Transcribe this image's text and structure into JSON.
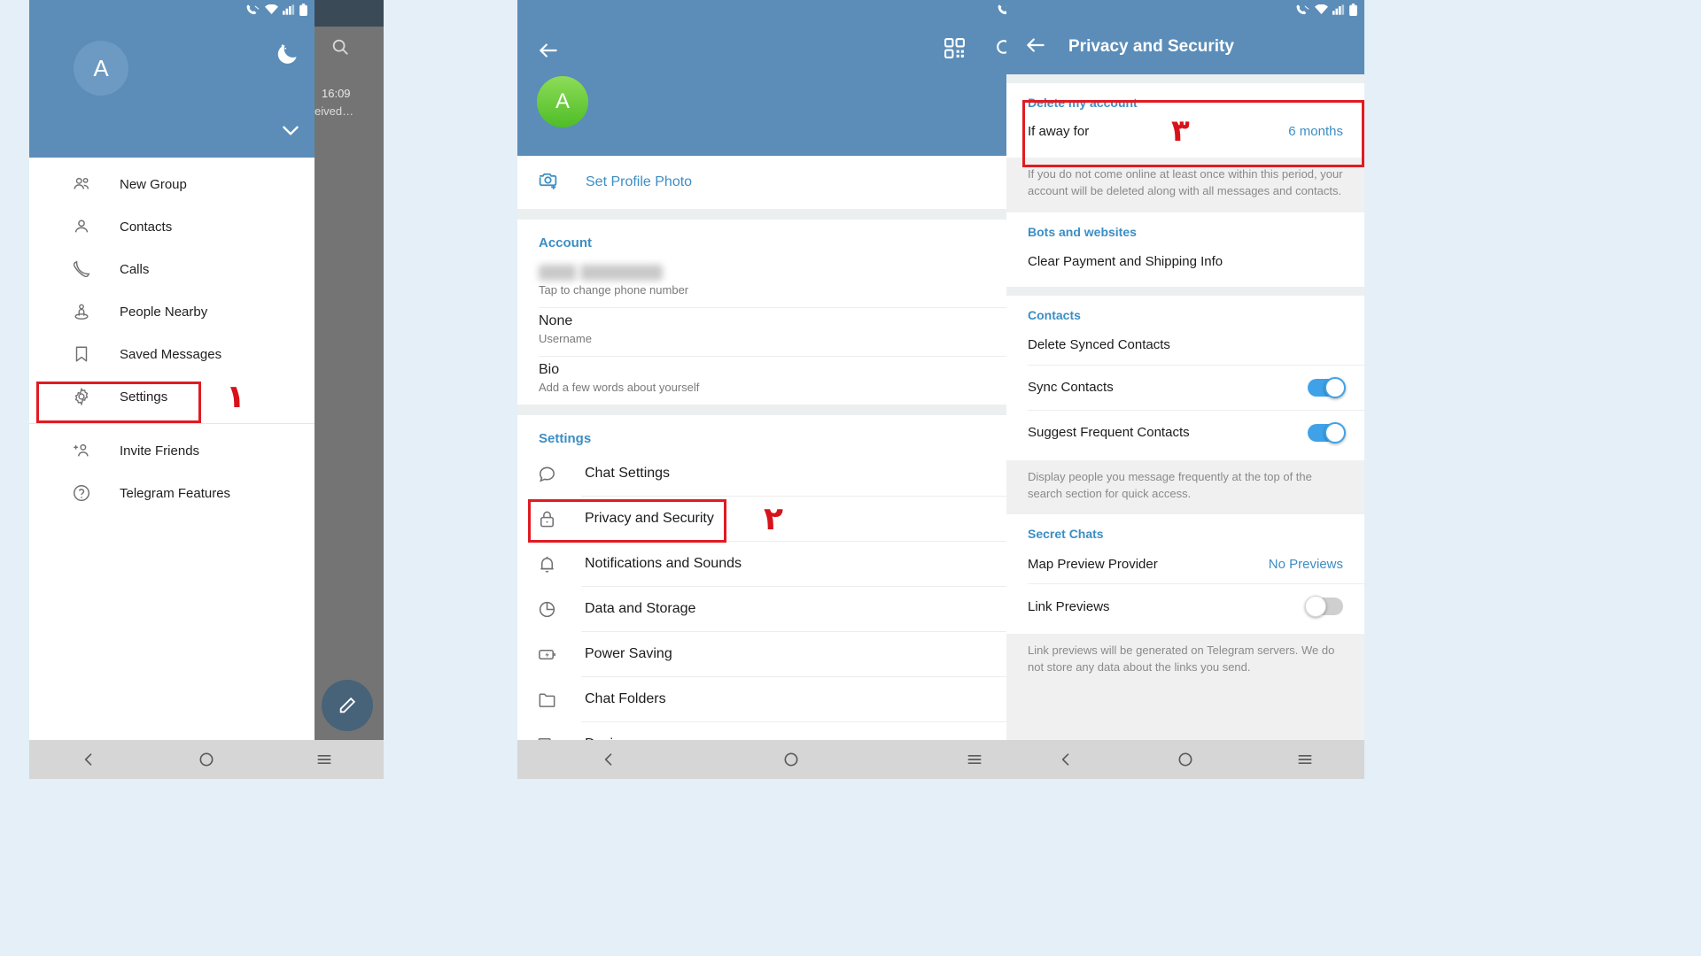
{
  "colors": {
    "telegram_blue": "#5b8db8",
    "accent_blue": "#3c8ec4",
    "annotation_red": "#e01b22",
    "toggle_on": "#3fa2e8",
    "avatar_green": "#4fbd27",
    "page_background": "#e4eff7"
  },
  "panel1": {
    "avatar_letter": "A",
    "chat_preview": {
      "time": "16:09",
      "text": "eived…"
    },
    "menu_items": [
      {
        "label": "New Group",
        "icon": "people-icon"
      },
      {
        "label": "Contacts",
        "icon": "person-icon"
      },
      {
        "label": "Calls",
        "icon": "phone-icon"
      },
      {
        "label": "People Nearby",
        "icon": "people-nearby-icon"
      },
      {
        "label": "Saved Messages",
        "icon": "bookmark-icon"
      },
      {
        "label": "Settings",
        "icon": "gear-icon"
      },
      {
        "label": "Invite Friends",
        "icon": "person-add-icon"
      },
      {
        "label": "Telegram Features",
        "icon": "help-circle-icon"
      }
    ],
    "annotation_number": "١"
  },
  "panel2": {
    "avatar_letter": "A",
    "set_profile_photo": "Set Profile Photo",
    "account_section": {
      "title": "Account",
      "phone_value": "",
      "phone_hint": "Tap to change phone number",
      "username_value": "None",
      "username_hint": "Username",
      "bio_value": "Bio",
      "bio_hint": "Add a few words about yourself"
    },
    "settings_section": {
      "title": "Settings",
      "items": [
        {
          "label": "Chat Settings",
          "icon": "chat-bubble-icon"
        },
        {
          "label": "Privacy and Security",
          "icon": "lock-icon"
        },
        {
          "label": "Notifications and Sounds",
          "icon": "bell-icon"
        },
        {
          "label": "Data and Storage",
          "icon": "pie-chart-icon"
        },
        {
          "label": "Power Saving",
          "icon": "battery-bolt-icon"
        },
        {
          "label": "Chat Folders",
          "icon": "folder-icon"
        },
        {
          "label": "Devices",
          "icon": "devices-icon"
        }
      ]
    },
    "annotation_number": "٢"
  },
  "panel3": {
    "title": "Privacy and Security",
    "delete_account": {
      "section_title": "Delete my account",
      "row_label": "If away for",
      "row_value": "6 months",
      "note": "If you do not come online at least once within this period, your account will be deleted along with all messages and contacts."
    },
    "bots_and_websites": {
      "section_title": "Bots and websites",
      "row_label": "Clear Payment and Shipping Info"
    },
    "contacts": {
      "section_title": "Contacts",
      "delete_synced": "Delete Synced Contacts",
      "sync_contacts": {
        "label": "Sync Contacts",
        "state": "on"
      },
      "suggest_frequent": {
        "label": "Suggest Frequent Contacts",
        "state": "on"
      },
      "note": "Display people you message frequently at the top of the search section for quick access."
    },
    "secret_chats": {
      "section_title": "Secret Chats",
      "map_preview": {
        "label": "Map Preview Provider",
        "value": "No Previews"
      },
      "link_previews": {
        "label": "Link Previews",
        "state": "off"
      },
      "note": "Link previews will be generated on Telegram servers. We do not store any data about the links you send."
    },
    "annotation_number": "٣"
  },
  "navbar": {
    "back": "nav-back-icon",
    "home": "nav-home-icon",
    "recents": "nav-recents-icon"
  }
}
